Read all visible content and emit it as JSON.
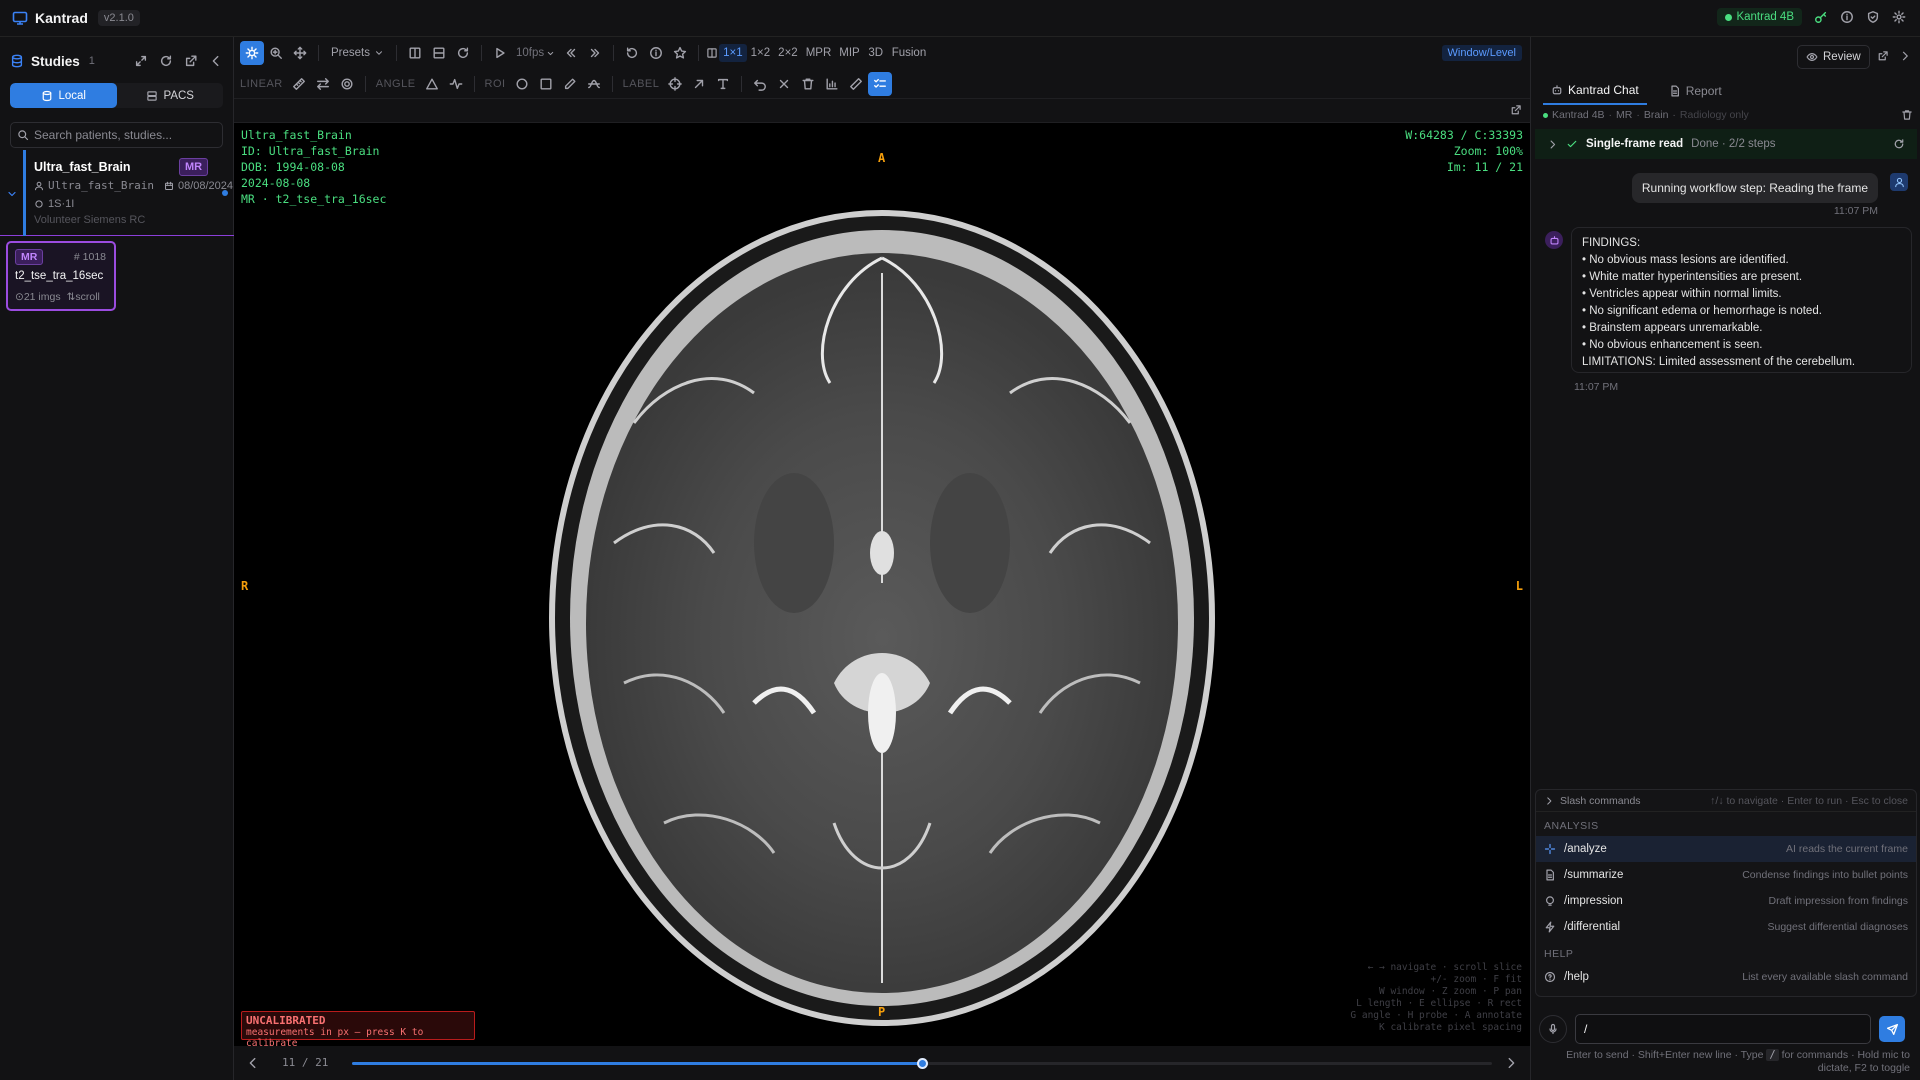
{
  "app": {
    "name": "Kantrad",
    "version": "v2.1.0",
    "model_badge": "Kantrad 4B"
  },
  "sidebar": {
    "title": "Studies",
    "count": "1",
    "tabs": [
      {
        "label": "Local"
      },
      {
        "label": "PACS"
      }
    ],
    "search_placeholder": "Search patients, studies...",
    "study": {
      "name": "Ultra_fast_Brain",
      "modality": "MR",
      "patient": "Ultra_fast_Brain",
      "date": "08/08/2024",
      "series_count": "1S·1I",
      "institution": "Volunteer Siemens RC"
    },
    "series": {
      "modality": "MR",
      "number": "1018",
      "name": "t2_tse_tra_16sec",
      "images": "21 imgs",
      "hint": "scroll"
    }
  },
  "toolbar": {
    "presets": "Presets",
    "fps": "10fps",
    "layouts": [
      "1×1",
      "1×2",
      "2×2",
      "MPR",
      "MIP",
      "3D",
      "Fusion"
    ],
    "mode": "Window/Level",
    "group_labels": {
      "linear": "LINEAR",
      "angle": "ANGLE",
      "roi": "ROI",
      "label": "LABEL"
    }
  },
  "viewer": {
    "overlay_left": [
      "Ultra_fast_Brain",
      "ID: Ultra_fast_Brain",
      "DOB: 1994-08-08",
      "2024-08-08",
      "MR · t2_tse_tra_16sec"
    ],
    "overlay_right": [
      "W:64283 / C:33393",
      "Zoom: 100%",
      "Im: 11 / 21"
    ],
    "orientation": {
      "top": "A",
      "bottom": "P",
      "left": "R",
      "right": "L"
    },
    "keys": [
      "← → navigate · scroll slice",
      "+/- zoom · F fit",
      "W window · Z zoom · P pan",
      "L length · E ellipse · R rect",
      "G angle · H probe · A annotate",
      "K calibrate pixel spacing"
    ],
    "uncalibrated_title": "UNCALIBRATED",
    "uncalibrated_sub": "measurements in px — press K to calibrate"
  },
  "slider": {
    "label": "11 / 21",
    "progress": 0.5
  },
  "chat": {
    "review_label": "Review",
    "tabs": [
      "Kantrad Chat",
      "Report"
    ],
    "context": [
      "Kantrad 4B",
      "MR",
      "Brain",
      "Radiology only"
    ],
    "workflow": {
      "name": "Single-frame read",
      "status": "Done · 2/2 steps"
    },
    "user_message": "Running workflow step: Reading the frame",
    "user_time": "11:07 PM",
    "assistant_lines": [
      "FINDINGS:",
      "• No obvious mass lesions are identified.",
      "• White matter hyperintensities are present.",
      "• Ventricles appear within normal limits.",
      "• No significant edema or hemorrhage is noted.",
      "• Brainstem appears unremarkable.",
      "• No obvious enhancement is seen.",
      "LIMITATIONS: Limited assessment of the cerebellum."
    ],
    "assistant_time": "11:07 PM",
    "slash": {
      "title": "Slash commands",
      "hint": "↑/↓ to navigate · Enter to run · Esc to close",
      "sections": [
        {
          "name": "ANALYSIS",
          "items": [
            {
              "cmd": "/analyze",
              "desc": "AI reads the current frame"
            },
            {
              "cmd": "/summarize",
              "desc": "Condense findings into bullet points"
            },
            {
              "cmd": "/impression",
              "desc": "Draft impression from findings"
            },
            {
              "cmd": "/differential",
              "desc": "Suggest differential diagnoses"
            }
          ]
        },
        {
          "name": "HELP",
          "items": [
            {
              "cmd": "/help",
              "desc": "List every available slash command"
            }
          ]
        }
      ]
    },
    "input_value": "/",
    "footer_a": "Enter to send · Shift+Enter new line · Type",
    "footer_key": "/",
    "footer_b": "for commands · Hold mic to",
    "footer_c": "dictate, F2 to toggle"
  }
}
